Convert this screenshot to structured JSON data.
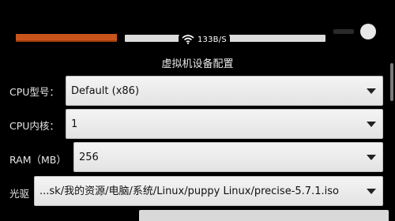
{
  "status": {
    "net_speed": "133B/S"
  },
  "dialog": {
    "title": "虚拟机设备配置"
  },
  "fields": {
    "cpu_type": {
      "label": "CPU型号：",
      "value": "Default (x86)"
    },
    "cpu_cores": {
      "label": "CPU内核：",
      "value": "1"
    },
    "ram": {
      "label": "RAM（MB）",
      "value": "256"
    },
    "cdrom": {
      "label": "光驱",
      "value": "...sk/我的资源/电脑/系统/Linux/puppy Linux/precise-5.7.1.iso"
    }
  },
  "colors": {
    "progress_orange": "#c9541b",
    "select_bg": "#ececec"
  },
  "icons": {
    "wifi": "wifi-icon",
    "dropdown": "chevron-down-icon"
  }
}
